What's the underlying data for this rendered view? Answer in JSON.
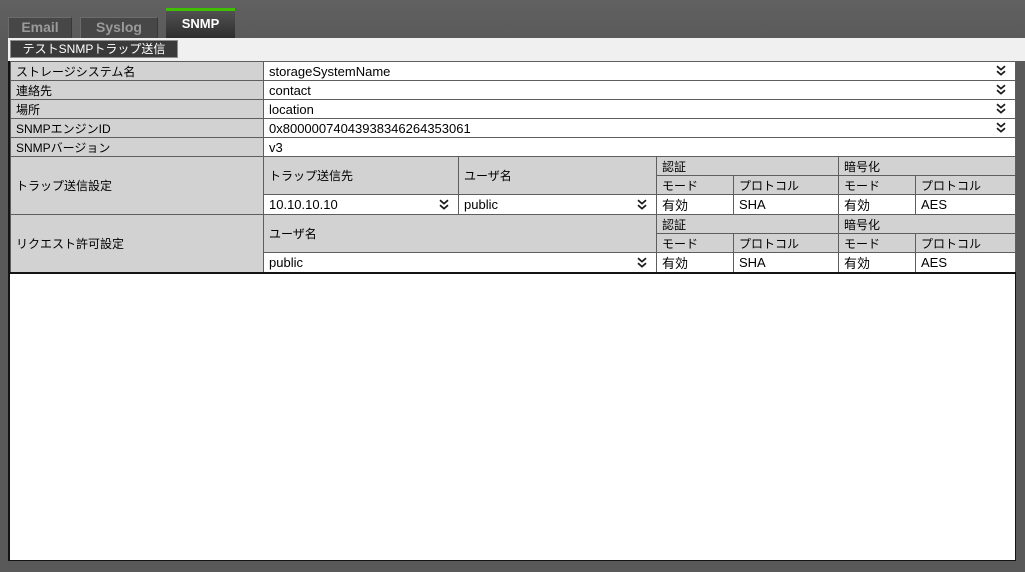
{
  "tabs": [
    {
      "label": "Email",
      "active": false
    },
    {
      "label": "Syslog",
      "active": false
    },
    {
      "label": "SNMP",
      "active": true
    }
  ],
  "toolbar": {
    "test_trap_button": "テストSNMPトラップ送信"
  },
  "settings_rows": [
    {
      "label": "ストレージシステム名",
      "value": "storageSystemName",
      "expandable": true
    },
    {
      "label": "連絡先",
      "value": "contact",
      "expandable": true
    },
    {
      "label": "場所",
      "value": "location",
      "expandable": true
    },
    {
      "label": "SNMPエンジンID",
      "value": "0x80000074043938346264353061",
      "expandable": true
    },
    {
      "label": "SNMPバージョン",
      "value": "v3",
      "expandable": false
    }
  ],
  "trap_settings": {
    "label": "トラップ送信設定",
    "headers": {
      "destination": "トラップ送信先",
      "user": "ユーザ名",
      "auth": "認証",
      "encryption": "暗号化",
      "mode": "モード",
      "protocol": "プロトコル"
    },
    "row": {
      "destination": "10.10.10.10",
      "user": "public",
      "auth_mode": "有効",
      "auth_protocol": "SHA",
      "enc_mode": "有効",
      "enc_protocol": "AES"
    }
  },
  "request_settings": {
    "label": "リクエスト許可設定",
    "headers": {
      "user": "ユーザ名",
      "auth": "認証",
      "encryption": "暗号化",
      "mode": "モード",
      "protocol": "プロトコル"
    },
    "row": {
      "user": "public",
      "auth_mode": "有効",
      "auth_protocol": "SHA",
      "enc_mode": "有効",
      "enc_protocol": "AES"
    }
  },
  "icons": {
    "expand_icon": "double-chevron-down"
  },
  "colors": {
    "accent_green": "#3fbf00",
    "frame_gray": "#595959",
    "header_cell_gray": "#d2d2d2"
  }
}
